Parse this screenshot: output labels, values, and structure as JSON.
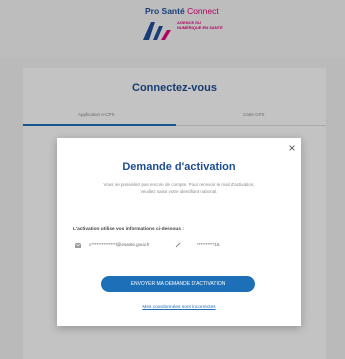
{
  "header": {
    "brand_main": "Pro Santé",
    "brand_accent": "Connect",
    "agency_text": "AGENCE DU NUMÉRIQUE EN SANTÉ"
  },
  "card": {
    "title": "Connectez-vous",
    "tabs": [
      {
        "label": "Application e-CPS"
      },
      {
        "label": "Carte CPS"
      }
    ]
  },
  "modal": {
    "title": "Demande d'activation",
    "description": "Vous ne possédez pas encore de compte. Pour recevoir le mail d'activation, veuillez saisir votre identifiant national.",
    "info_label": "L'activation utilise vos informations ci-dessous :",
    "email_value": "c**************l@esante.gouv.fr",
    "phone_value": "**********16",
    "send_button": "ENVOYER MA DEMANDE D'ACTIVATION",
    "incorrect_link": "Mes coordonnées sont incorrectes",
    "close_symbol": "×"
  },
  "colors": {
    "brand_blue": "#1d4e8f",
    "button_blue": "#1d6fb8",
    "accent_pink": "#e4007d"
  },
  "icons": [
    "close-icon",
    "mail-icon",
    "edit-icon",
    "ans-logo-icon"
  ]
}
